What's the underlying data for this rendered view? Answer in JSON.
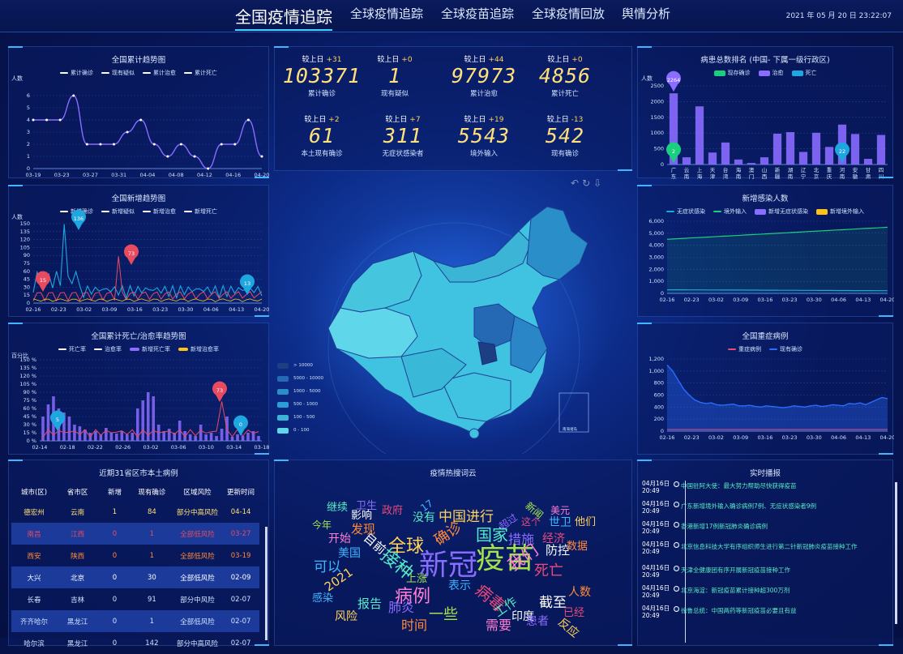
{
  "header": {
    "tabs": [
      "全国疫情追踪",
      "全球疫情追踪",
      "全球疫苗追踪",
      "全球疫情回放",
      "舆情分析"
    ],
    "datetime": "2021 年 05 月 20 日 23:22:07"
  },
  "colors": {
    "accent": "#39d4ff",
    "yellow": "#ffe07a",
    "green": "#55ecc6",
    "red": "#e84a5f",
    "purple": "#8a6cff"
  },
  "trend": {
    "title": "全国累计趋势图",
    "legend": [
      "累计确诊",
      "现有疑似",
      "累计治愈",
      "累计死亡"
    ],
    "ylabel": "人数",
    "chart_data": {
      "type": "line",
      "x": [
        "03-19",
        "03-23",
        "03-27",
        "03-31",
        "04-04",
        "04-08",
        "04-12",
        "04-16",
        "04-20"
      ],
      "yticks": [
        "0",
        "1",
        "2",
        "3",
        "4",
        "5",
        "6"
      ],
      "ylim": [
        0,
        6
      ],
      "series": [
        {
          "name": "现有疑似",
          "values": [
            4,
            4,
            4,
            6,
            2,
            2,
            2,
            3,
            4,
            2,
            1,
            2,
            1,
            0,
            2,
            2,
            4,
            1
          ]
        }
      ]
    }
  },
  "newtrend": {
    "title": "全国新增趋势图",
    "legend": [
      "新增确诊",
      "新增疑似",
      "新增治愈",
      "新增死亡"
    ],
    "ylabel": "人数",
    "yticks": [
      "0",
      "15",
      "30",
      "45",
      "60",
      "75",
      "90",
      "105",
      "120",
      "135",
      "150"
    ],
    "x": [
      "02-16",
      "02-23",
      "03-02",
      "03-09",
      "03-16",
      "03-23",
      "03-30",
      "04-06",
      "04-13",
      "04-20"
    ],
    "pins": [
      "15",
      "136",
      "73",
      "13"
    ]
  },
  "death": {
    "title": "全国累计死亡/治愈率趋势图",
    "legend": [
      "死亡率",
      "治愈率",
      "新增死亡率",
      "新增治愈率"
    ],
    "ylabel": "百分比",
    "yticks": [
      "0 %",
      "15 %",
      "30 %",
      "45 %",
      "60 %",
      "75 %",
      "90 %",
      "105 %",
      "120 %",
      "135 %",
      "150 %"
    ],
    "x": [
      "02-14",
      "02-18",
      "02-22",
      "02-26",
      "03-02",
      "03-06",
      "03-10",
      "03-14",
      "03-18"
    ],
    "pins": [
      "5",
      "73",
      "0"
    ]
  },
  "stats": [
    {
      "cmp": "较上日",
      "delta": "+31",
      "num": "103371",
      "label": "累计确诊"
    },
    {
      "cmp": "较上日",
      "delta": "+0",
      "num": "1",
      "label": "现有疑似"
    },
    {
      "cmp": "较上日",
      "delta": "+44",
      "num": "97973",
      "label": "累计治愈"
    },
    {
      "cmp": "较上日",
      "delta": "+0",
      "num": "4856",
      "label": "累计死亡"
    },
    {
      "cmp": "较上日",
      "delta": "+2",
      "num": "61",
      "label": "本土现有确诊"
    },
    {
      "cmp": "较上日",
      "delta": "+7",
      "num": "311",
      "label": "无症状感染者"
    },
    {
      "cmp": "较上日",
      "delta": "+19",
      "num": "5543",
      "label": "境外输入"
    },
    {
      "cmp": "较上日",
      "delta": "-13",
      "num": "542",
      "label": "现有确诊"
    }
  ],
  "map": {
    "legend": [
      "> 10000",
      "5000 - 10000",
      "1000 - 5000",
      "500 - 1000",
      "100 - 500",
      "0 - 100"
    ],
    "inset_label": "南海诸岛"
  },
  "ranking": {
    "title": "病患总数排名 (中国- 下属一级行政区)",
    "legend": [
      "现存确诊",
      "治愈",
      "死亡"
    ],
    "ylabel": "人数",
    "yticks": [
      "0",
      "500",
      "1000",
      "1500",
      "2000",
      "2500"
    ],
    "chart_data": {
      "type": "bar",
      "categories": [
        "广东",
        "云南",
        "上海",
        "天津",
        "台湾",
        "海南",
        "澳门",
        "山西",
        "新疆",
        "湖南",
        "辽宁",
        "北京",
        "重庆",
        "河南",
        "安徽",
        "甘肃",
        "四川"
      ],
      "values": [
        2264,
        230,
        1850,
        380,
        700,
        160,
        50,
        230,
        980,
        1030,
        400,
        1010,
        560,
        1270,
        970,
        180,
        940
      ]
    },
    "pins": [
      "2264",
      "2",
      "22"
    ]
  },
  "infected": {
    "title": "新增感染人数",
    "legend": [
      "无症状感染",
      "境外输入",
      "新增无症状感染",
      "新增境外输入"
    ],
    "yticks": [
      "0",
      "1,000",
      "2,000",
      "3,000",
      "4,000",
      "5,000",
      "6,000"
    ],
    "x": [
      "02-16",
      "02-23",
      "03-02",
      "03-09",
      "03-16",
      "03-23",
      "03-30",
      "04-06",
      "04-13",
      "04-20"
    ]
  },
  "severe": {
    "title": "全国重症病例",
    "legend": [
      "重症病例",
      "现有确诊"
    ],
    "yticks": [
      "0",
      "200",
      "400",
      "600",
      "800",
      "1,000",
      "1,200"
    ],
    "x": [
      "02-16",
      "02-23",
      "03-02",
      "03-09",
      "03-16",
      "03-23",
      "03-30",
      "04-06",
      "04-13",
      "04-20"
    ]
  },
  "cases": {
    "title": "近期31省区市本土病例",
    "headers": [
      "城市(区)",
      "省市区",
      "新增",
      "现有确诊",
      "区域风险",
      "更新时间"
    ],
    "rows": [
      [
        "德宏州",
        "云南",
        "1",
        "84",
        "部分中高风险",
        "04-14"
      ],
      [
        "南昌",
        "江西",
        "0",
        "1",
        "全部低风险",
        "03-27"
      ],
      [
        "西安",
        "陕西",
        "0",
        "1",
        "全部低风险",
        "03-19"
      ],
      [
        "大兴",
        "北京",
        "0",
        "30",
        "全部低风险",
        "02-09"
      ],
      [
        "长春",
        "吉林",
        "0",
        "91",
        "部分中风险",
        "02-07"
      ],
      [
        "齐齐哈尔",
        "黑龙江",
        "0",
        "1",
        "全部低风险",
        "02-07"
      ],
      [
        "哈尔滨",
        "黑龙江",
        "0",
        "142",
        "部分中高风险",
        "02-07"
      ]
    ]
  },
  "cloud": {
    "title": "疫情热搜词云",
    "words": [
      "继续",
      "卫生",
      "政府",
      "17",
      "中国进行",
      "新闻",
      "美元",
      "影响",
      "发现",
      "没有",
      "超过",
      "这个",
      "世卫",
      "他们",
      "今年",
      "开始",
      "目前",
      "确诊",
      "国家",
      "措施",
      "经济",
      "美国",
      "全球",
      "疫苗",
      "我们",
      "防控",
      "数据",
      "接种",
      "新冠",
      "死亡",
      "可以",
      "2021",
      "上涨",
      "病例",
      "截至",
      "人数",
      "报告",
      "肺炎",
      "病毒",
      "感染",
      "风险",
      "一些",
      "需要",
      "印度",
      "时间",
      "工作",
      "患者",
      "已经",
      "表示",
      "反应"
    ]
  },
  "news": {
    "title": "实时播报",
    "items": [
      {
        "date": "04月16日",
        "time": "20:49",
        "text": "中国驻阿大使：最大努力帮助尽快获得疫苗"
      },
      {
        "date": "04月16日",
        "time": "20:49",
        "text": "广东新增境外输入确诊病例7例、无症状感染者9例"
      },
      {
        "date": "04月16日",
        "time": "20:49",
        "text": "香港新增17例新冠肺炎确诊病例"
      },
      {
        "date": "04月16日",
        "time": "20:49",
        "text": "北京信息科技大学有序组织师生进行第二针新冠肺炎疫苗接种工作"
      },
      {
        "date": "04月16日",
        "time": "20:49",
        "text": "天津全健康团有序开展新冠疫苗接种工作"
      },
      {
        "date": "04月16日",
        "time": "20:49",
        "text": "北京海淀：新冠疫苗累计接种超300万剂"
      },
      {
        "date": "04月16日",
        "time": "20:49",
        "text": "徐鲁总统：中国两药等新冠疫苗必要且有益"
      }
    ]
  }
}
